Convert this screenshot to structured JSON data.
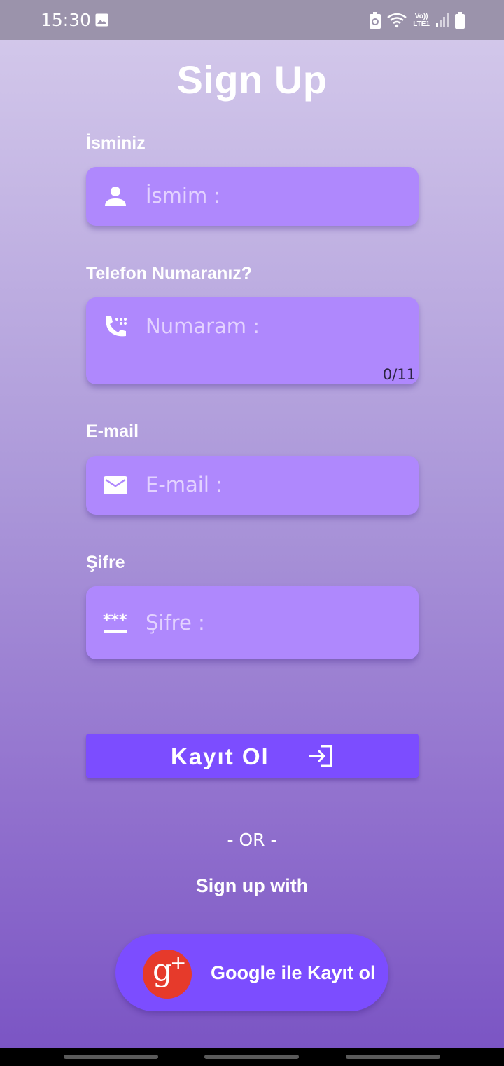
{
  "status_bar": {
    "time": "15:30",
    "icons": [
      "image-icon",
      "battery-saver-icon",
      "wifi-icon",
      "volte-icon",
      "signal-icon",
      "battery-icon"
    ],
    "volte_line1": "Vo))",
    "volte_line2": "LTE1"
  },
  "form": {
    "title": "Sign Up",
    "name": {
      "label": "İsminiz",
      "placeholder": "İsmim :",
      "icon": "person-icon"
    },
    "phone": {
      "label": "Telefon Numaranız?",
      "placeholder": "Numaram :",
      "counter": "0/11",
      "icon": "dialpad-phone-icon"
    },
    "email": {
      "label": "E-mail",
      "placeholder": "E-mail :",
      "icon": "mail-icon"
    },
    "password": {
      "label": "Şifre",
      "placeholder": "Şifre :",
      "icon": "password-icon"
    }
  },
  "submit": {
    "label": "Kayıt Ol",
    "icon": "login-arrow-icon"
  },
  "divider": "- OR -",
  "alt_signup": {
    "caption": "Sign up with",
    "google_label": "Google ile Kayıt ol",
    "google_icon": "google-plus-icon",
    "google_g": "g",
    "google_plus": "+"
  },
  "colors": {
    "field_bg": "#af88fd",
    "button_bg": "#7c4dff",
    "google_red": "#e63a2b",
    "status_bar": "#9b93ab"
  }
}
